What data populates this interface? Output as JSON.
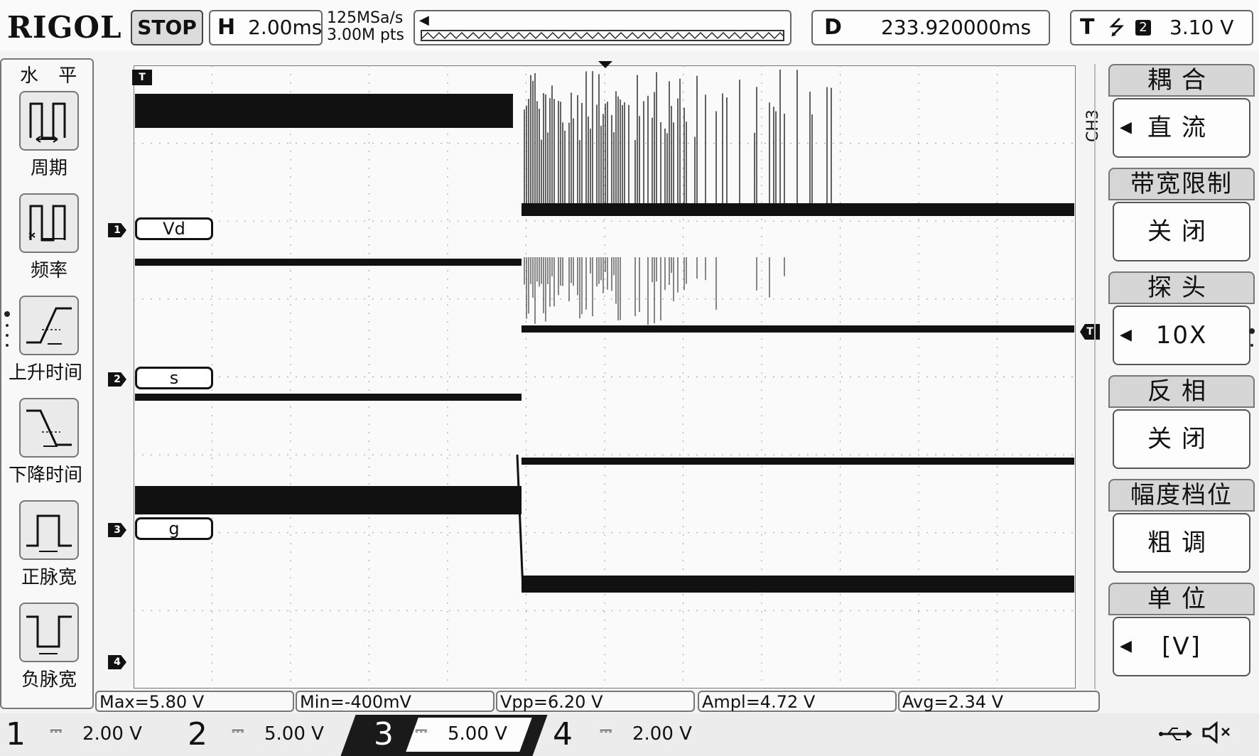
{
  "header": {
    "brand": "RIGOL",
    "run_state": "STOP",
    "timebase_label": "H",
    "timebase_value": "2.00ms",
    "sample_rate": "125MSa/s",
    "memory_depth": "3.00M pts",
    "delay_label": "D",
    "delay_value": "233.920000ms",
    "trigger_label": "T",
    "trigger_slope": "⭍",
    "trigger_source": "2",
    "trigger_level": "3.10 V"
  },
  "left_menu": {
    "title": "水 平",
    "items": [
      {
        "label": "周期",
        "icon": "period-icon"
      },
      {
        "label": "频率",
        "icon": "frequency-icon"
      },
      {
        "label": "上升时间",
        "icon": "rise-time-icon"
      },
      {
        "label": "下降时间",
        "icon": "fall-time-icon"
      },
      {
        "label": "正脉宽",
        "icon": "positive-width-icon"
      },
      {
        "label": "负脉宽",
        "icon": "negative-width-icon"
      }
    ]
  },
  "channels_on_screen": [
    {
      "num": "1",
      "tag": "Vd"
    },
    {
      "num": "2",
      "tag": "s"
    },
    {
      "num": "3",
      "tag": "g"
    },
    {
      "num": "4",
      "tag": ""
    }
  ],
  "right_menu": {
    "channel": "CH3",
    "groups": [
      {
        "title": "耦合",
        "value": "直流",
        "has_arrow": true
      },
      {
        "title": "带宽限制",
        "value": "关闭",
        "has_arrow": false
      },
      {
        "title": "探头",
        "value": "10X",
        "has_arrow": true
      },
      {
        "title": "反相",
        "value": "关闭",
        "has_arrow": false
      },
      {
        "title": "幅度档位",
        "value": "粗调",
        "has_arrow": false
      },
      {
        "title": "单位",
        "value": "[V]",
        "has_arrow": true
      }
    ]
  },
  "measurements": [
    "Max=5.80 V",
    "Min=-400mV",
    "Vpp=6.20 V",
    "Ampl=4.72 V",
    "Avg=2.34 V"
  ],
  "bottom": {
    "channels": [
      {
        "num": "1",
        "coupling": "⎓",
        "scale": "2.00 V"
      },
      {
        "num": "2",
        "coupling": "⎓",
        "scale": "5.00 V"
      },
      {
        "num": "3",
        "coupling": "⎓",
        "scale": "5.00 V"
      },
      {
        "num": "4",
        "coupling": "⎓",
        "scale": "2.00 V"
      }
    ],
    "usb_icon": "usb-icon",
    "speaker_icon": "speaker-muted-icon"
  },
  "colors": {
    "trace": "#111111",
    "grid": "#9a9a9a",
    "background": "#f4f4f4"
  }
}
